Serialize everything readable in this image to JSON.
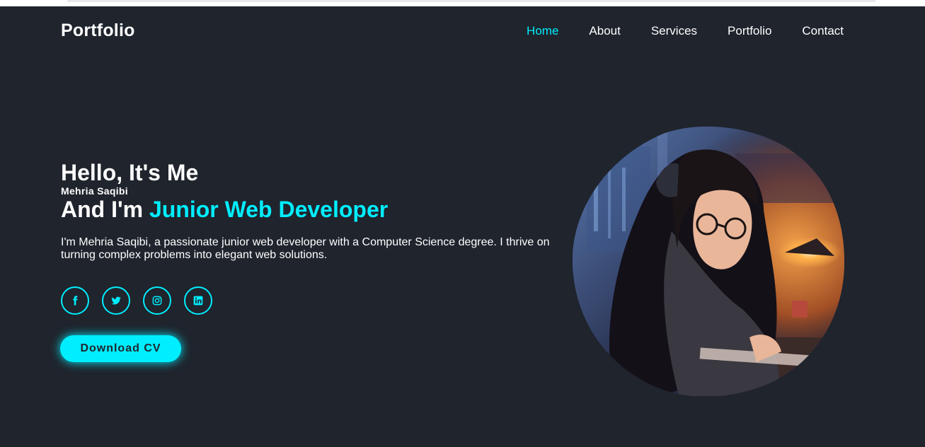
{
  "header": {
    "logo": "Portfolio",
    "nav": [
      {
        "label": "Home",
        "active": true
      },
      {
        "label": "About",
        "active": false
      },
      {
        "label": "Services",
        "active": false
      },
      {
        "label": "Portfolio",
        "active": false
      },
      {
        "label": "Contact",
        "active": false
      }
    ]
  },
  "hero": {
    "greeting": "Hello, It's Me",
    "name": "Mehria Saqibi",
    "role_prefix": "And I'm ",
    "role": "Junior Web Developer",
    "bio": "I'm Mehria Saqibi, a passionate junior web developer with a Computer Science degree. I thrive on turning complex problems into elegant web solutions.",
    "socials": [
      {
        "icon": "facebook-icon"
      },
      {
        "icon": "twitter-icon"
      },
      {
        "icon": "instagram-icon"
      },
      {
        "icon": "linkedin-icon"
      }
    ],
    "cta": "Download CV"
  },
  "colors": {
    "background": "#1f242d",
    "accent": "#00eeff",
    "text": "#ffffff"
  }
}
